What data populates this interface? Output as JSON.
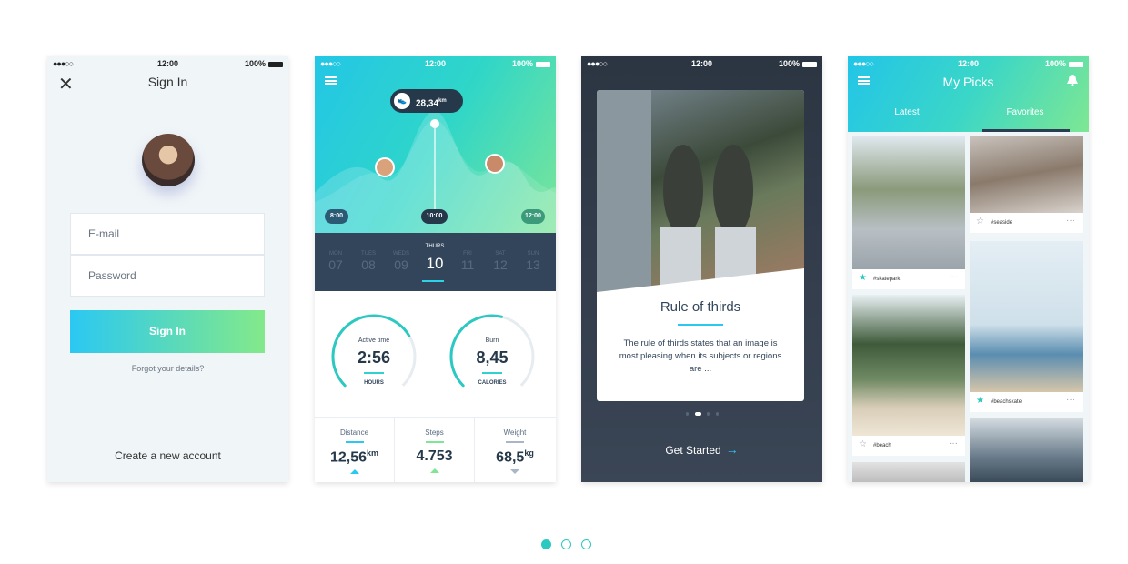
{
  "status": {
    "carrier": "●●●○○",
    "time": "12:00",
    "battery": "100%"
  },
  "signin": {
    "title": "Sign In",
    "email_placeholder": "E-mail",
    "password_placeholder": "Password",
    "button": "Sign In",
    "forgot": "Forgot your details?",
    "create": "Create a new account"
  },
  "fitness": {
    "bubble_value": "28,34",
    "bubble_unit": "km",
    "pill_start": "8:00",
    "pill_mid": "10:00",
    "pill_end": "12:00",
    "days": [
      {
        "name": "MON",
        "num": "07"
      },
      {
        "name": "TUES",
        "num": "08"
      },
      {
        "name": "WEDS",
        "num": "09"
      },
      {
        "name": "THURS",
        "num": "10"
      },
      {
        "name": "FRI",
        "num": "11"
      },
      {
        "name": "SAT",
        "num": "12"
      },
      {
        "name": "SUN",
        "num": "13"
      }
    ],
    "gauge1": {
      "label": "Active time",
      "value": "2:56",
      "unit": "HOURS",
      "level": 0.72
    },
    "gauge2": {
      "label": "Burn",
      "value": "8,45",
      "unit": "CALORIES",
      "level": 0.55
    },
    "stats": [
      {
        "label": "Distance",
        "value": "12,56",
        "unit": "km",
        "color": "#2bc8f2"
      },
      {
        "label": "Steps",
        "value": "4.753",
        "unit": "",
        "color": "#7ee793"
      },
      {
        "label": "Weight",
        "value": "68,5",
        "unit": "kg",
        "color": "#a9b6c8"
      }
    ]
  },
  "onboard": {
    "title": "Rule of thirds",
    "text": "The rule of thirds states that an image is most pleasing when its subjects or regions are ...",
    "cta": "Get Started",
    "arrow": "→"
  },
  "picks": {
    "title": "My Picks",
    "tabs": [
      "Latest",
      "Favorites"
    ],
    "tags": [
      "#skatepark",
      "#seaside",
      "#beachskate",
      "#beach"
    ]
  },
  "carousel": {
    "active": 0,
    "count": 3
  },
  "colors": {
    "accent": "#2bc8f2",
    "green": "#7ee793",
    "teal": "#2bc9c2",
    "dark": "#26394a"
  }
}
